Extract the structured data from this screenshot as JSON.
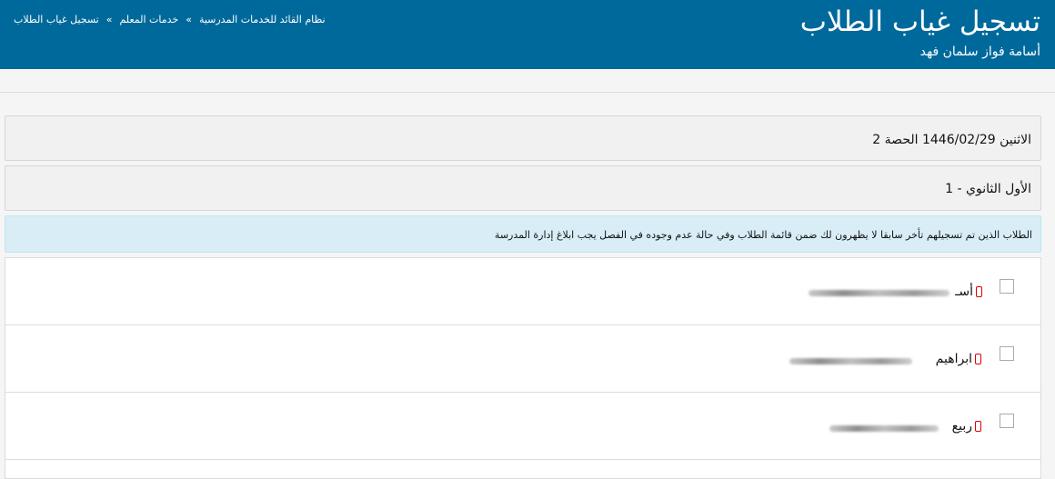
{
  "header": {
    "title": "تسجيل غياب الطلاب",
    "user_name": "أسامة فواز سلمان فهد"
  },
  "breadcrumb": {
    "items": [
      "نظام القائد للخدمات المدرسية",
      "خدمات المعلم",
      "تسجيل غياب الطلاب"
    ],
    "separator": "»"
  },
  "session": {
    "date_line": "الاثنين 1446/02/29 الحصة 2",
    "class_name": "الأول الثانوي - 1"
  },
  "alert": {
    "text": "الطلاب الذين تم تسجيلهم تأخر سابقا لا يظهرون لك ضمن قائمة الطلاب وفي حالة عدم وجوده في الفصل يجب ابلاغ إدارة المدرسة"
  },
  "students": [
    {
      "visible_name": "أسـ",
      "icon": "mobile-phone-icon",
      "redacted": true
    },
    {
      "visible_name": "ابراهيم",
      "icon": "mobile-phone-icon",
      "redacted": true
    },
    {
      "visible_name": "ربيع",
      "icon": "mobile-phone-icon",
      "redacted": true
    }
  ],
  "colors": {
    "header_bg": "#00699b",
    "alert_bg": "#d9edf7",
    "phone_icon": "#e00000"
  }
}
